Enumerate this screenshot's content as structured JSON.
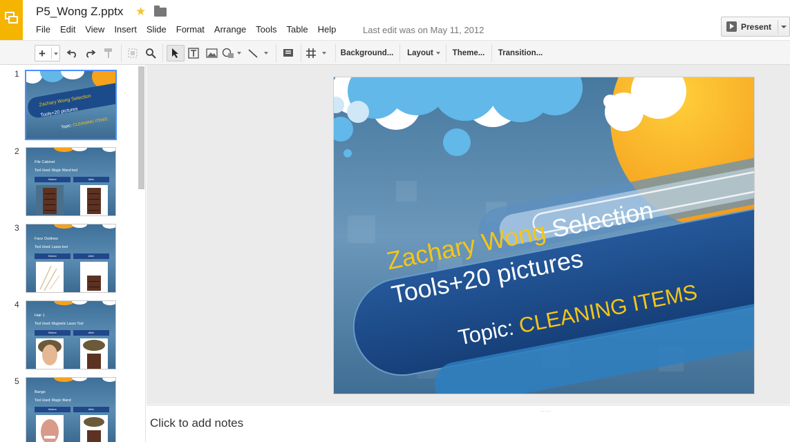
{
  "document": {
    "title": "P5_Wong Z.pptx",
    "last_edit": "Last edit was on May 11, 2012"
  },
  "menu": [
    "File",
    "Edit",
    "View",
    "Insert",
    "Slide",
    "Format",
    "Arrange",
    "Tools",
    "Table",
    "Help"
  ],
  "present_button": {
    "label": "Present"
  },
  "toolbar": {
    "background_label": "Background...",
    "layout_label": "Layout",
    "theme_label": "Theme...",
    "transition_label": "Transition...",
    "icons": [
      "plus-icon",
      "undo-icon",
      "redo-icon",
      "paint-format-icon",
      "select-frame-icon",
      "zoom-icon",
      "cursor-icon",
      "text-box-icon",
      "image-icon",
      "shape-icon",
      "line-icon",
      "comment-icon",
      "table-icon"
    ]
  },
  "slides": [
    {
      "number": "1",
      "selected": true,
      "title": "Zachary Wong Selection",
      "subtitle": "Tools+20 pictures",
      "topic_prefix": "Topic:",
      "topic": "CLEANING ITEMS"
    },
    {
      "number": "2",
      "title": "File Cabinet",
      "tool": "Tool Used: Magic Wand tool",
      "before": "Before",
      "after": "After"
    },
    {
      "number": "3",
      "title": "Face Outlines",
      "tool": "Tool Used: Lasso tool",
      "before": "Before",
      "after": "After"
    },
    {
      "number": "4",
      "title": "Hair 1",
      "tool": "Tool Used: Magnetic Lasso Tool",
      "before": "Before",
      "after": "After"
    },
    {
      "number": "5",
      "title": "Bangs",
      "tool": "Tool Used: Magic Wand",
      "before": "Before",
      "after": "After"
    }
  ],
  "main_slide": {
    "line1_name": "Zachary Wong",
    "line1_rest": "Selection",
    "line2": "Tools+20 pictures",
    "topic_prefix": "Topic:",
    "topic": "CLEANING ITEMS",
    "colors": {
      "accent_yellow": "#f5c518",
      "band_blue": "#1b4b8a",
      "bubble_blue": "#62b8e8",
      "sun_orange": "#f7a21b"
    }
  },
  "notes": {
    "placeholder": "Click to add notes"
  }
}
